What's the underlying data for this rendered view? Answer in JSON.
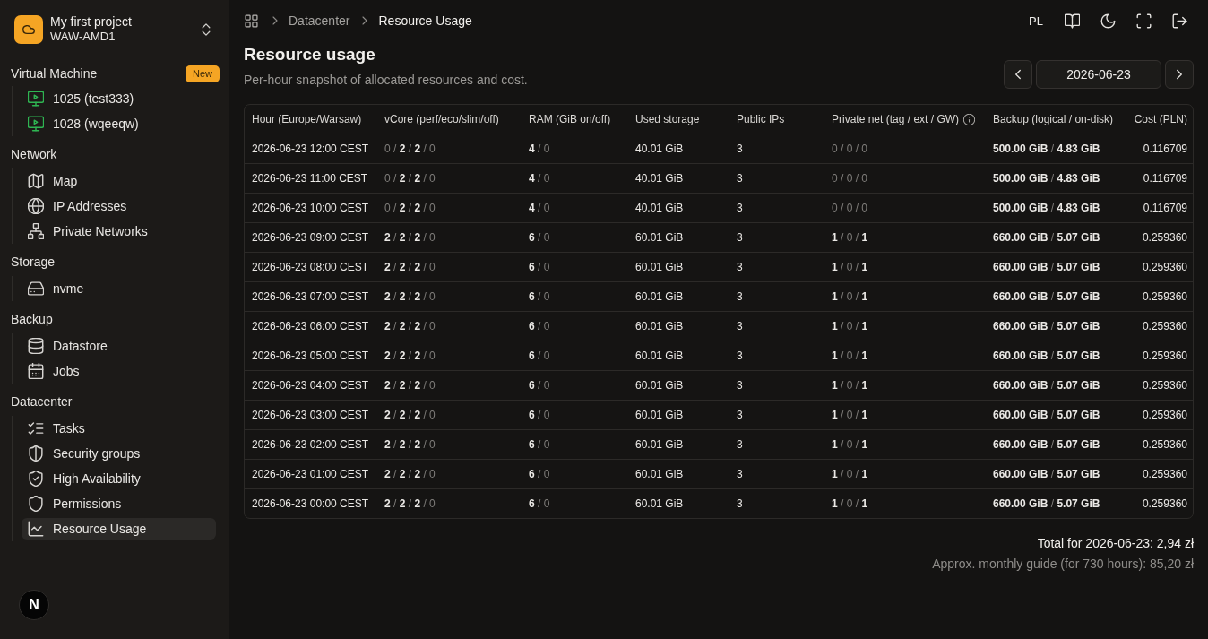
{
  "sidebar": {
    "project": {
      "name": "My first project",
      "region": "WAW-AMD1"
    },
    "sections": [
      {
        "title": "Virtual Machine",
        "badge": "New",
        "items": [
          {
            "label": "1025 (test333)",
            "selected": false
          },
          {
            "label": "1028 (wqeeqw)",
            "selected": false
          }
        ]
      },
      {
        "title": "Network",
        "items": [
          {
            "label": "Map",
            "selected": false
          },
          {
            "label": "IP Addresses",
            "selected": false
          },
          {
            "label": "Private Networks",
            "selected": false
          }
        ]
      },
      {
        "title": "Storage",
        "items": [
          {
            "label": "nvme",
            "selected": false
          }
        ]
      },
      {
        "title": "Backup",
        "items": [
          {
            "label": "Datastore",
            "selected": false
          },
          {
            "label": "Jobs",
            "selected": false
          }
        ]
      },
      {
        "title": "Datacenter",
        "items": [
          {
            "label": "Tasks",
            "selected": false
          },
          {
            "label": "Security groups",
            "selected": false
          },
          {
            "label": "High Availability",
            "selected": false
          },
          {
            "label": "Permissions",
            "selected": false
          },
          {
            "label": "Resource Usage",
            "selected": true
          }
        ]
      }
    ],
    "dev_indicator": "N"
  },
  "topbar": {
    "breadcrumb": [
      {
        "label": "Datacenter",
        "current": false
      },
      {
        "label": "Resource Usage",
        "current": true
      }
    ],
    "language": "PL"
  },
  "page": {
    "title": "Resource usage",
    "subtitle": "Per-hour snapshot of allocated resources and cost.",
    "date": "2026-06-23"
  },
  "table": {
    "columns": [
      {
        "label": "Hour (Europe/Warsaw)",
        "info": false
      },
      {
        "label": "vCore (perf/eco/slim/off)",
        "info": false
      },
      {
        "label": "RAM (GiB on/off)",
        "info": false
      },
      {
        "label": "Used storage",
        "info": false
      },
      {
        "label": "Public IPs",
        "info": false
      },
      {
        "label": "Private net (tag / ext / GW)",
        "info": true
      },
      {
        "label": "Backup (logical / on-disk)",
        "info": false
      },
      {
        "label": "Cost (PLN)",
        "info": false
      }
    ],
    "rows": [
      [
        "2026-06-23 12:00 CEST",
        "0 / **2** / **2** / 0",
        "**4** / 0",
        "40.01 GiB",
        "3",
        "0 / 0 / 0",
        "**500.00 GiB** / **4.83 GiB**",
        "0.116709"
      ],
      [
        "2026-06-23 11:00 CEST",
        "0 / **2** / **2** / 0",
        "**4** / 0",
        "40.01 GiB",
        "3",
        "0 / 0 / 0",
        "**500.00 GiB** / **4.83 GiB**",
        "0.116709"
      ],
      [
        "2026-06-23 10:00 CEST",
        "0 / **2** / **2** / 0",
        "**4** / 0",
        "40.01 GiB",
        "3",
        "0 / 0 / 0",
        "**500.00 GiB** / **4.83 GiB**",
        "0.116709"
      ],
      [
        "2026-06-23 09:00 CEST",
        "**2** / **2** / **2** / 0",
        "**6** / 0",
        "60.01 GiB",
        "3",
        "**1** / 0 / **1**",
        "**660.00 GiB** / **5.07 GiB**",
        "0.259360"
      ],
      [
        "2026-06-23 08:00 CEST",
        "**2** / **2** / **2** / 0",
        "**6** / 0",
        "60.01 GiB",
        "3",
        "**1** / 0 / **1**",
        "**660.00 GiB** / **5.07 GiB**",
        "0.259360"
      ],
      [
        "2026-06-23 07:00 CEST",
        "**2** / **2** / **2** / 0",
        "**6** / 0",
        "60.01 GiB",
        "3",
        "**1** / 0 / **1**",
        "**660.00 GiB** / **5.07 GiB**",
        "0.259360"
      ],
      [
        "2026-06-23 06:00 CEST",
        "**2** / **2** / **2** / 0",
        "**6** / 0",
        "60.01 GiB",
        "3",
        "**1** / 0 / **1**",
        "**660.00 GiB** / **5.07 GiB**",
        "0.259360"
      ],
      [
        "2026-06-23 05:00 CEST",
        "**2** / **2** / **2** / 0",
        "**6** / 0",
        "60.01 GiB",
        "3",
        "**1** / 0 / **1**",
        "**660.00 GiB** / **5.07 GiB**",
        "0.259360"
      ],
      [
        "2026-06-23 04:00 CEST",
        "**2** / **2** / **2** / 0",
        "**6** / 0",
        "60.01 GiB",
        "3",
        "**1** / 0 / **1**",
        "**660.00 GiB** / **5.07 GiB**",
        "0.259360"
      ],
      [
        "2026-06-23 03:00 CEST",
        "**2** / **2** / **2** / 0",
        "**6** / 0",
        "60.01 GiB",
        "3",
        "**1** / 0 / **1**",
        "**660.00 GiB** / **5.07 GiB**",
        "0.259360"
      ],
      [
        "2026-06-23 02:00 CEST",
        "**2** / **2** / **2** / 0",
        "**6** / 0",
        "60.01 GiB",
        "3",
        "**1** / 0 / **1**",
        "**660.00 GiB** / **5.07 GiB**",
        "0.259360"
      ],
      [
        "2026-06-23 01:00 CEST",
        "**2** / **2** / **2** / 0",
        "**6** / 0",
        "60.01 GiB",
        "3",
        "**1** / 0 / **1**",
        "**660.00 GiB** / **5.07 GiB**",
        "0.259360"
      ],
      [
        "2026-06-23 00:00 CEST",
        "**2** / **2** / **2** / 0",
        "**6** / 0",
        "60.01 GiB",
        "3",
        "**1** / 0 / **1**",
        "**660.00 GiB** / **5.07 GiB**",
        "0.259360"
      ]
    ]
  },
  "summary": {
    "total": "Total for 2026-06-23: 2,94 zł",
    "monthly_guide": "Approx. monthly guide (for 730 hours): 85,20 zł"
  }
}
